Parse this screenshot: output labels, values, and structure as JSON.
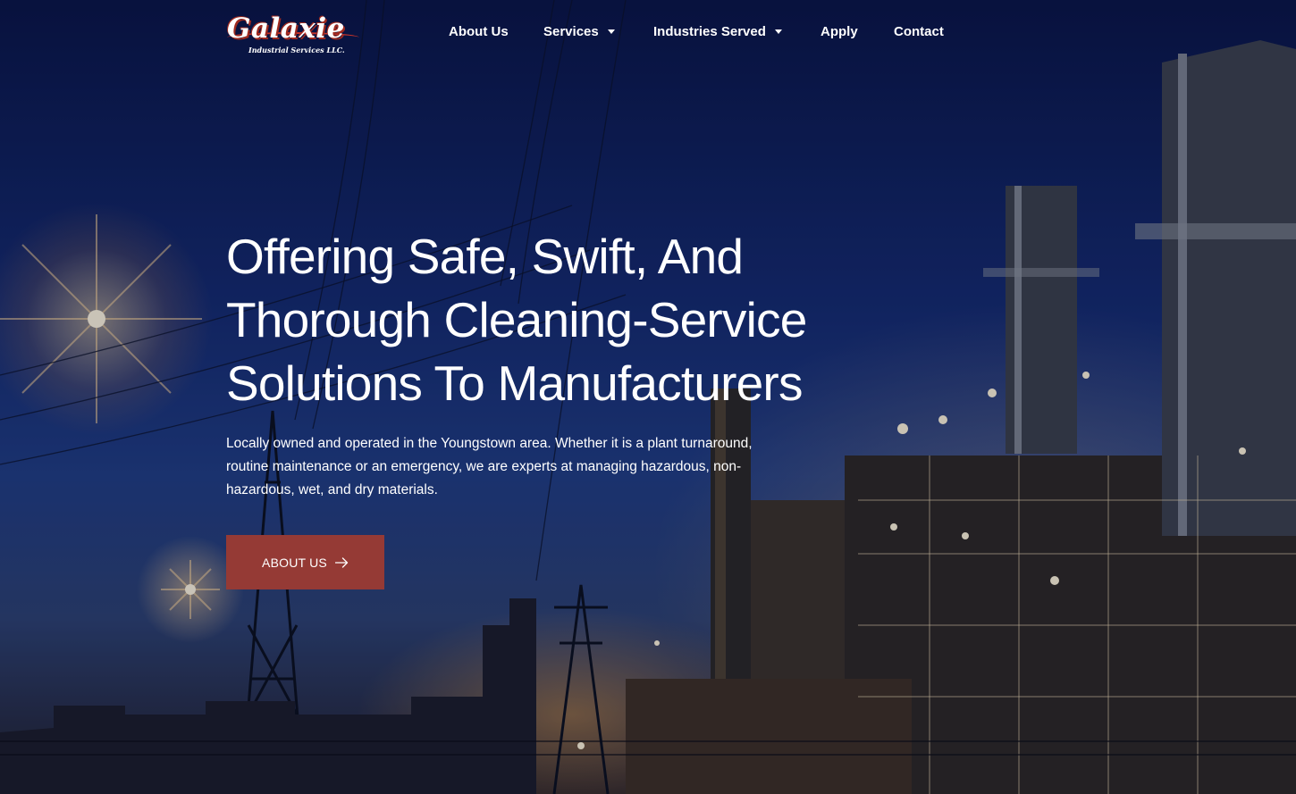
{
  "brand": {
    "logo_name": "Galaxie",
    "logo_tagline": "Industrial Services LLC."
  },
  "nav": {
    "items": [
      {
        "label": "About Us",
        "has_dropdown": false
      },
      {
        "label": "Services",
        "has_dropdown": true
      },
      {
        "label": "Industries Served",
        "has_dropdown": true
      },
      {
        "label": "Apply",
        "has_dropdown": false
      },
      {
        "label": "Contact",
        "has_dropdown": false
      }
    ]
  },
  "hero": {
    "headline_lines": [
      "Offering Safe, Swift, And",
      "Thorough Cleaning-Service",
      "Solutions To Manufacturers"
    ],
    "intro_lines": [
      "Locally owned and operated in the Youngstown area. Whether it is a plant turnaround,",
      "routine maintenance or an emergency, we are experts at managing hazardous, non-",
      "hazardous, wet, and dry materials."
    ],
    "cta_label": "ABOUT US",
    "cta_icon": "arrow-right-icon",
    "background_image": "industrial-plant-at-night-photo"
  },
  "colors": {
    "cta_background": "#953a35",
    "logo_accent": "#c6332a",
    "text": "#ffffff"
  }
}
